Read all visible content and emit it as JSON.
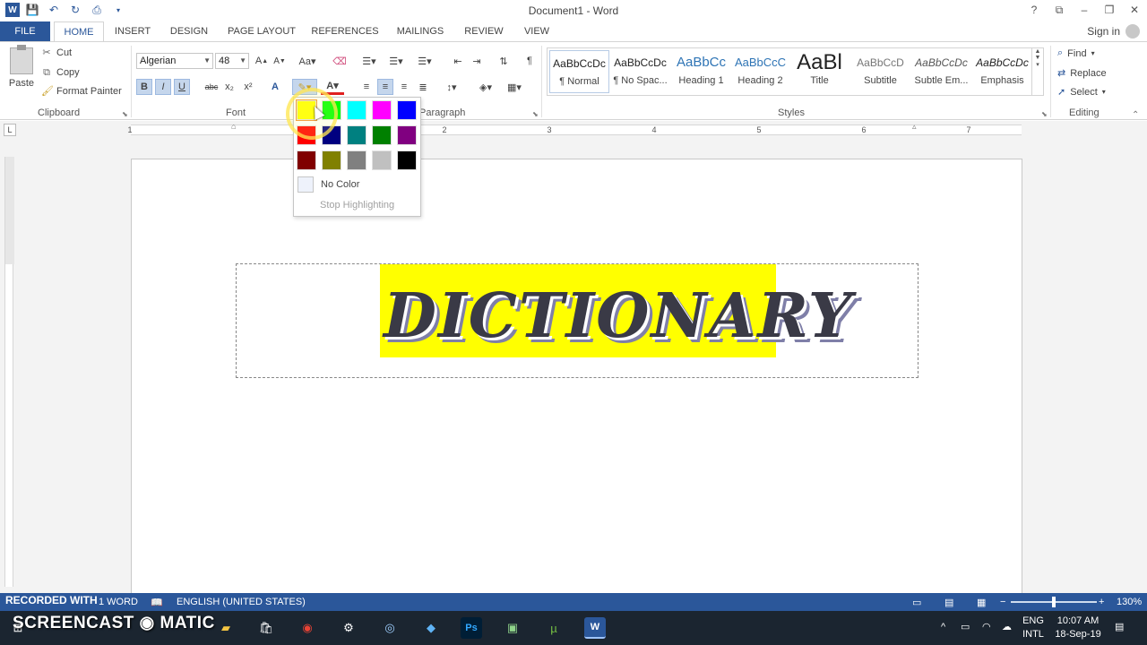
{
  "window": {
    "title": "Document1 - Word",
    "controls": [
      "?",
      "⧉",
      "–",
      "❐",
      "✕"
    ]
  },
  "tabs": [
    {
      "label": "FILE"
    },
    {
      "label": "HOME"
    },
    {
      "label": "INSERT"
    },
    {
      "label": "DESIGN"
    },
    {
      "label": "PAGE LAYOUT"
    },
    {
      "label": "REFERENCES"
    },
    {
      "label": "MAILINGS"
    },
    {
      "label": "REVIEW"
    },
    {
      "label": "VIEW"
    }
  ],
  "active_tab": "HOME",
  "signin": "Sign in",
  "clipboard": {
    "paste": "Paste",
    "cut": "Cut",
    "copy": "Copy",
    "format_painter": "Format Painter",
    "group": "Clipboard"
  },
  "font": {
    "name": "Algerian",
    "size": "48",
    "group": "Font",
    "buttons": [
      "B",
      "I",
      "U",
      "abc",
      "x₂",
      "x²"
    ]
  },
  "paragraph": {
    "group": "Paragraph"
  },
  "styles": {
    "group": "Styles",
    "items": [
      {
        "preview": "AaBbCcDc",
        "name": "¶ Normal"
      },
      {
        "preview": "AaBbCcDc",
        "name": "¶ No Spac..."
      },
      {
        "preview": "AaBbCc",
        "name": "Heading 1"
      },
      {
        "preview": "AaBbCcC",
        "name": "Heading 2"
      },
      {
        "preview": "AaBl",
        "name": "Title"
      },
      {
        "preview": "AaBbCcD",
        "name": "Subtitle"
      },
      {
        "preview": "AaBbCcDc",
        "name": "Subtle Em..."
      },
      {
        "preview": "AaBbCcDc",
        "name": "Emphasis"
      }
    ]
  },
  "editing": {
    "group": "Editing",
    "find": "Find",
    "replace": "Replace",
    "select": "Select"
  },
  "ruler": {
    "numbers": [
      "1",
      "1",
      "2",
      "3",
      "4",
      "5",
      "6",
      "7"
    ]
  },
  "highlight_menu": {
    "colors": [
      "#ffff00",
      "#00ff00",
      "#00ffff",
      "#ff00ff",
      "#0000ff",
      "#ff0000",
      "#000080",
      "#008080",
      "#008000",
      "#800080",
      "#800000",
      "#808000",
      "#808080",
      "#c0c0c0",
      "#000000"
    ],
    "selected": "#ffff00",
    "no_color": "No Color",
    "stop": "Stop Highlighting"
  },
  "document": {
    "wordart_text": "DICTIONARY",
    "highlight_color": "#ffff00"
  },
  "statusbar": {
    "words": "1 WORD",
    "language": "ENGLISH (UNITED STATES)",
    "zoom": "130%",
    "zoom_fraction": 0.5
  },
  "watermark": {
    "line1": "RECORDED WITH",
    "line2": "SCREENCAST ◉ MATIC"
  },
  "taskbar": {
    "lang1": "ENG",
    "lang2": "INTL",
    "time": "10:07 AM",
    "date": "18-Sep-19"
  }
}
